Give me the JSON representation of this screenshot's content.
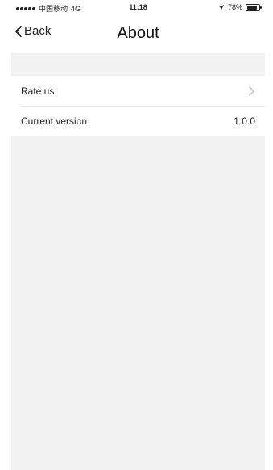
{
  "status_bar": {
    "carrier": "中国移动",
    "network": "4G",
    "time": "11:18",
    "battery": "78%",
    "battery_level": 0.78
  },
  "navbar": {
    "back_label": "Back",
    "title": "About"
  },
  "list": {
    "items": [
      {
        "label": "Rate us",
        "value": "",
        "icon": "chevron-right-icon"
      },
      {
        "label": "Current version",
        "value": "1.0.0"
      }
    ]
  },
  "colors": {
    "background": "#f2f2f2",
    "surface": "#ffffff",
    "divider": "#e6e6e6",
    "text": "#222222",
    "chevron": "#c7c7cc"
  }
}
